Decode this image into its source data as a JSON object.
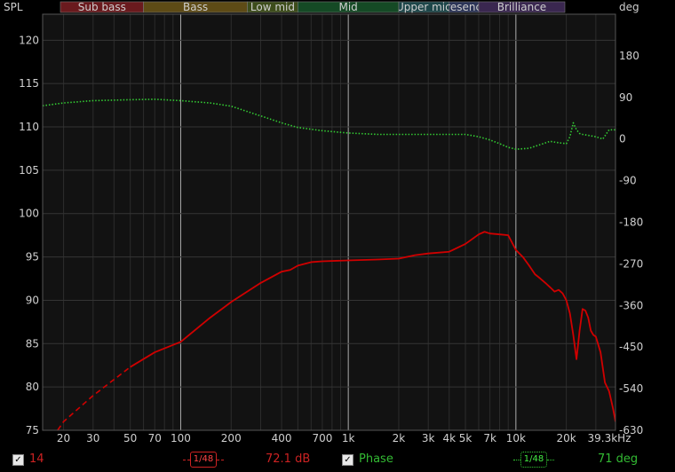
{
  "chart_data": {
    "type": "line",
    "left_axis_label": "SPL",
    "right_axis_label": "deg",
    "x_scale": "log",
    "xlim": [
      15,
      39300
    ],
    "ylim_left": [
      75,
      123
    ],
    "ylim_right": [
      -630,
      270
    ],
    "x_ticks": [
      {
        "v": 20,
        "label": "20"
      },
      {
        "v": 30,
        "label": "30"
      },
      {
        "v": 50,
        "label": "50"
      },
      {
        "v": 70,
        "label": "70"
      },
      {
        "v": 100,
        "label": "100"
      },
      {
        "v": 200,
        "label": "200"
      },
      {
        "v": 400,
        "label": "400"
      },
      {
        "v": 700,
        "label": "700"
      },
      {
        "v": 1000,
        "label": "1k"
      },
      {
        "v": 2000,
        "label": "2k"
      },
      {
        "v": 3000,
        "label": "3k"
      },
      {
        "v": 4000,
        "label": "4k"
      },
      {
        "v": 5000,
        "label": "5k"
      },
      {
        "v": 7000,
        "label": "7k"
      },
      {
        "v": 10000,
        "label": "10k"
      },
      {
        "v": 20000,
        "label": "20k"
      },
      {
        "v": 39300,
        "label": "39.3kHz"
      }
    ],
    "y_ticks_left": [
      75,
      80,
      85,
      90,
      95,
      100,
      105,
      110,
      115,
      120
    ],
    "y_ticks_right": [
      180,
      90,
      0,
      -90,
      -180,
      -270,
      -360,
      -450,
      -540,
      -630
    ],
    "bands": [
      {
        "name": "Sub bass",
        "from": 15,
        "to": 60,
        "color": "#6a1a1e"
      },
      {
        "name": "Bass",
        "from": 60,
        "to": 250,
        "color": "#5e4b16"
      },
      {
        "name": "Low mid",
        "from": 250,
        "to": 500,
        "color": "#3d4d1b"
      },
      {
        "name": "Mid",
        "from": 500,
        "to": 2000,
        "color": "#154a25"
      },
      {
        "name": "Upper mid",
        "from": 2000,
        "to": 4000,
        "color": "#1d4649"
      },
      {
        "name": "Presence",
        "from": 4000,
        "to": 6000,
        "color": "#2b3457"
      },
      {
        "name": "Brilliance",
        "from": 6000,
        "to": 20000,
        "color": "#3a2750"
      }
    ],
    "series": [
      {
        "name": "",
        "axis": "left",
        "color": "#d00000",
        "x": [
          15,
          20,
          30,
          50,
          70,
          100,
          150,
          200,
          300,
          400,
          450,
          500,
          600,
          700,
          1000,
          1500,
          2000,
          2500,
          3000,
          4000,
          5000,
          6000,
          6500,
          7000,
          8000,
          9000,
          10000,
          11000,
          12000,
          13000,
          14000,
          15000,
          16000,
          17000,
          18000,
          19000,
          20000,
          21000,
          22000,
          23000,
          24000,
          25000,
          26000,
          27000,
          28000,
          29000,
          30000,
          32000,
          34000,
          36000,
          38000,
          39300
        ],
        "y": [
          72.5,
          76.0,
          79.0,
          82.3,
          84.0,
          85.2,
          88.0,
          89.8,
          92.0,
          93.3,
          93.5,
          94.0,
          94.4,
          94.5,
          94.6,
          94.7,
          94.8,
          95.2,
          95.4,
          95.6,
          96.5,
          97.6,
          97.9,
          97.7,
          97.6,
          97.5,
          95.8,
          95.0,
          94.0,
          93.0,
          92.5,
          92.0,
          91.5,
          91.0,
          91.2,
          90.8,
          90.0,
          88.5,
          86.0,
          83.2,
          86.5,
          89.0,
          88.8,
          88.0,
          86.5,
          86.0,
          85.8,
          84.0,
          80.5,
          79.5,
          77.5,
          76.0
        ],
        "dashed_below": 45
      },
      {
        "name": "Phase",
        "axis": "right",
        "color": "#33cc33",
        "style": "dotted",
        "x": [
          15,
          20,
          30,
          50,
          70,
          100,
          150,
          200,
          300,
          400,
          500,
          700,
          1000,
          1500,
          2000,
          3000,
          4000,
          5000,
          6000,
          7000,
          8000,
          9000,
          10000,
          12000,
          14000,
          16000,
          18000,
          20000,
          21000,
          22000,
          23000,
          24000,
          25000,
          27000,
          30000,
          33000,
          36000,
          39300
        ],
        "y": [
          72,
          78,
          83,
          85,
          86,
          83,
          78,
          71,
          50,
          35,
          25,
          18,
          13,
          10,
          10,
          10,
          10,
          10,
          5,
          -2,
          -10,
          -18,
          -22,
          -20,
          -12,
          -5,
          -8,
          -10,
          5,
          35,
          20,
          12,
          10,
          8,
          5,
          0,
          20,
          20
        ]
      }
    ]
  },
  "footer": {
    "check1": "✓",
    "left_value": "14",
    "smooth1_label": "1/48",
    "spl_readout": "72.1 dB",
    "check2": "✓",
    "phase_label": "Phase",
    "smooth2_label": "1/48",
    "phase_readout": "71 deg"
  }
}
